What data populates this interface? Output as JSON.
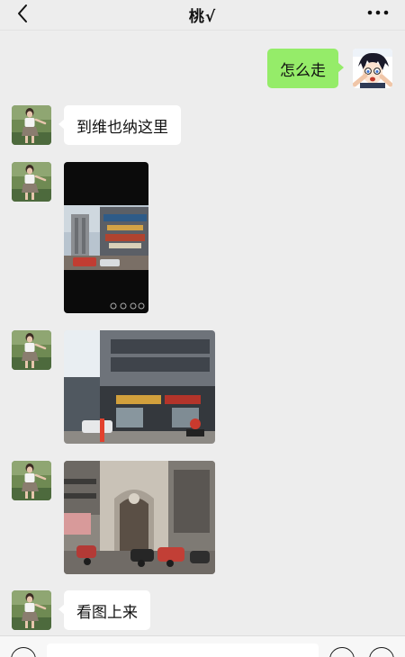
{
  "header": {
    "title": "桃√",
    "back_icon": "chevron-left-icon",
    "more_icon": "ellipsis-icon"
  },
  "messages": [
    {
      "side": "out",
      "type": "text",
      "text": "怎么走"
    },
    {
      "side": "in",
      "type": "text",
      "text": "到维也纳这里"
    },
    {
      "side": "in",
      "type": "image",
      "content": "video-thumbnail"
    },
    {
      "side": "in",
      "type": "image",
      "content": "street-building-photo"
    },
    {
      "side": "in",
      "type": "image",
      "content": "arched-entrance-photo"
    },
    {
      "side": "in",
      "type": "text",
      "text": "看图上来"
    }
  ],
  "input_bar": {
    "voice_icon": "voice-icon",
    "emoji_icon": "emoji-icon",
    "plus_icon": "plus-icon",
    "input_value": ""
  },
  "colors": {
    "background": "#ededed",
    "outgoing_bubble": "#95ec69",
    "incoming_bubble": "#ffffff"
  }
}
